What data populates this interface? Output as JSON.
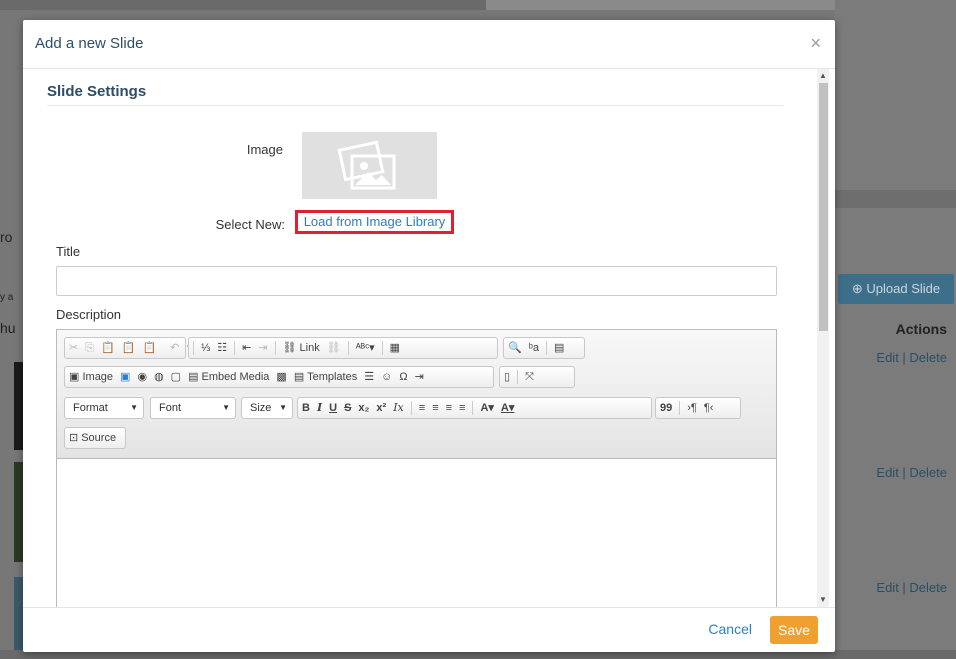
{
  "background": {
    "upload_button": "Upload Slide",
    "actions_header": "Actions",
    "row_actions": [
      "Edit | Delete",
      "Edit | Delete",
      "Edit | Delete"
    ],
    "left_fragments": [
      "ro",
      "y a",
      "hu"
    ]
  },
  "modal": {
    "title": "Add a new Slide",
    "close_symbol": "×",
    "section_title": "Slide Settings",
    "image_label": "Image",
    "select_new_label": "Select New:",
    "load_link": "Load from Image Library",
    "title_label": "Title",
    "title_value": "",
    "description_label": "Description",
    "footer": {
      "cancel": "Cancel",
      "save": "Save"
    }
  },
  "editor": {
    "row1": {
      "clipboard": [
        "✂",
        "⎘",
        "📋",
        "📋",
        "📋"
      ],
      "history": [
        "↶",
        "↷"
      ],
      "lists": [
        "⅓",
        "☷"
      ],
      "indent": [
        "⇤",
        "⇥"
      ],
      "link_label": "Link",
      "spell": "ᴬᴮᶜ▾",
      "find": [
        "🔍",
        "ᵇa"
      ],
      "misc": "▤"
    },
    "row2": {
      "image_label": "Image",
      "embed_label": "Embed Media",
      "templates_label": "Templates",
      "symbols": [
        "☺",
        "Ω"
      ]
    },
    "row3": {
      "format_label": "Format",
      "font_label": "Font",
      "size_label": "Size",
      "styles": [
        "B",
        "I",
        "U",
        "S",
        "x₂",
        "x²",
        "Ix"
      ],
      "align": [
        "≡",
        "≡",
        "≡",
        "≡"
      ],
      "colors": [
        "A▾",
        "A▾"
      ],
      "quote": "99"
    },
    "row4": {
      "source_label": "Source"
    }
  },
  "colors": {
    "accent": "#2e7dc2",
    "title": "#2f4d66",
    "save": "#f0a030",
    "highlight_border": "#e02030"
  }
}
